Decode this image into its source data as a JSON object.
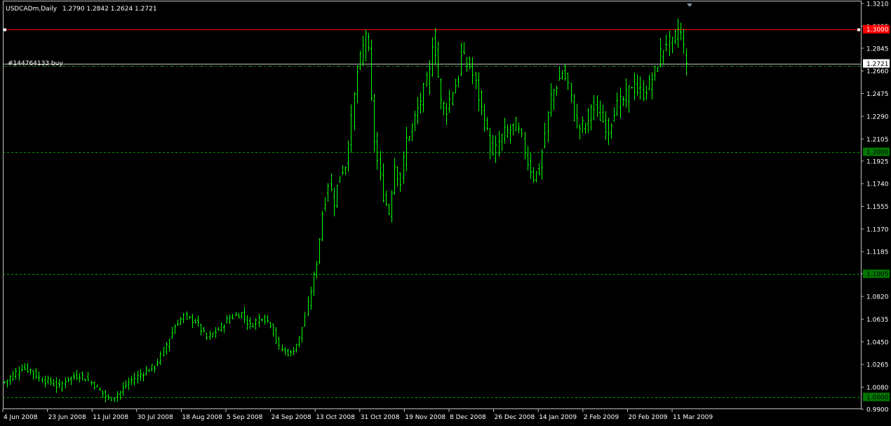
{
  "header": {
    "symbol": "USDCADm,Daily",
    "ohlc": "1.2790 1.2842 1.2624 1.2721"
  },
  "colors": {
    "background": "#000000",
    "frame": "#c0c0c0",
    "bar": "#00ff00",
    "resistance": "#ff0000",
    "order_line": "#c0c0c0",
    "grid_dash": "#00a000",
    "level_tag": "#007800",
    "text": "#ffffff"
  },
  "chart_data": {
    "type": "ohlc",
    "grid": false,
    "ylim": [
      0.99,
      1.321
    ],
    "y_ticks": [
      "1.3210",
      "1.3025",
      "1.2845",
      "1.2660",
      "1.2475",
      "1.2290",
      "1.2105",
      "1.1925",
      "1.1740",
      "1.1555",
      "1.1370",
      "1.1185",
      "1.1005",
      "1.0820",
      "1.0635",
      "1.0450",
      "1.0265",
      "1.0080",
      "0.9900"
    ],
    "x_labels": [
      "4 Jun 2008",
      "23 Jun 2008",
      "11 Jul 2008",
      "30 Jul 2008",
      "18 Aug 2008",
      "5 Sep 2008",
      "24 Sep 2008",
      "13 Oct 2008",
      "31 Oct 2008",
      "19 Nov 2008",
      "8 Dec 2008",
      "26 Dec 2008",
      "14 Jan 2009",
      "2 Feb 2009",
      "20 Feb 2009",
      "11 Mar 2009"
    ],
    "levels": [
      {
        "value": 1.3,
        "label": "1.3000",
        "style": "solid",
        "color": "#ff0000"
      },
      {
        "value": 1.2,
        "label": "1.2000",
        "style": "dashed",
        "color": "#00a000"
      },
      {
        "value": 1.1005,
        "label": "1.1005",
        "style": "dashed",
        "color": "#00a000"
      },
      {
        "value": 1.0,
        "label": "1.0000",
        "style": "dashed",
        "color": "#00a000"
      }
    ],
    "order_line": {
      "value": 1.27,
      "label": "#144764133 buy"
    },
    "current_price": {
      "value": 1.2721,
      "label": "1.2721"
    },
    "anchors": [
      [
        0,
        1.012
      ],
      [
        4,
        1.02
      ],
      [
        6,
        1.024
      ],
      [
        9,
        1.022
      ],
      [
        12,
        1.015
      ],
      [
        16,
        1.012
      ],
      [
        19,
        1.008
      ],
      [
        21,
        1.014
      ],
      [
        26,
        1.018
      ],
      [
        30,
        1.012
      ],
      [
        34,
        1.003
      ],
      [
        36,
        0.998
      ],
      [
        40,
        1.004
      ],
      [
        43,
        1.012
      ],
      [
        48,
        1.02
      ],
      [
        52,
        1.025
      ],
      [
        55,
        1.038
      ],
      [
        59,
        1.058
      ],
      [
        62,
        1.066
      ],
      [
        66,
        1.062
      ],
      [
        70,
        1.048
      ],
      [
        74,
        1.055
      ],
      [
        78,
        1.065
      ],
      [
        82,
        1.068
      ],
      [
        85,
        1.058
      ],
      [
        89,
        1.066
      ],
      [
        92,
        1.06
      ],
      [
        95,
        1.04
      ],
      [
        99,
        1.035
      ],
      [
        102,
        1.048
      ],
      [
        105,
        1.075
      ],
      [
        108,
        1.11
      ],
      [
        110,
        1.15
      ],
      [
        112,
        1.175
      ],
      [
        114,
        1.16
      ],
      [
        116,
        1.182
      ],
      [
        118,
        1.19
      ],
      [
        120,
        1.225
      ],
      [
        122,
        1.265
      ],
      [
        124,
        1.285
      ],
      [
        125,
        1.298
      ],
      [
        126,
        1.28
      ],
      [
        127,
        1.24
      ],
      [
        128,
        1.21
      ],
      [
        129,
        1.192
      ],
      [
        131,
        1.165
      ],
      [
        133,
        1.15
      ],
      [
        135,
        1.19
      ],
      [
        137,
        1.175
      ],
      [
        139,
        1.21
      ],
      [
        141,
        1.22
      ],
      [
        143,
        1.235
      ],
      [
        145,
        1.25
      ],
      [
        147,
        1.265
      ],
      [
        148,
        1.29
      ],
      [
        149,
        1.283
      ],
      [
        151,
        1.24
      ],
      [
        153,
        1.235
      ],
      [
        155,
        1.25
      ],
      [
        157,
        1.26
      ],
      [
        158,
        1.285
      ],
      [
        159,
        1.275
      ],
      [
        161,
        1.27
      ],
      [
        163,
        1.255
      ],
      [
        165,
        1.235
      ],
      [
        167,
        1.215
      ],
      [
        169,
        1.195
      ],
      [
        171,
        1.208
      ],
      [
        173,
        1.215
      ],
      [
        175,
        1.218
      ],
      [
        177,
        1.222
      ],
      [
        179,
        1.21
      ],
      [
        181,
        1.192
      ],
      [
        183,
        1.18
      ],
      [
        185,
        1.185
      ],
      [
        187,
        1.215
      ],
      [
        189,
        1.245
      ],
      [
        191,
        1.255
      ],
      [
        193,
        1.265
      ],
      [
        195,
        1.255
      ],
      [
        197,
        1.23
      ],
      [
        199,
        1.22
      ],
      [
        201,
        1.222
      ],
      [
        203,
        1.238
      ],
      [
        205,
        1.232
      ],
      [
        207,
        1.225
      ],
      [
        209,
        1.218
      ],
      [
        211,
        1.235
      ],
      [
        213,
        1.24
      ],
      [
        215,
        1.245
      ],
      [
        217,
        1.255
      ],
      [
        219,
        1.25
      ],
      [
        221,
        1.248
      ],
      [
        223,
        1.255
      ],
      [
        225,
        1.265
      ],
      [
        227,
        1.28
      ],
      [
        229,
        1.29
      ],
      [
        231,
        1.288
      ],
      [
        233,
        1.3
      ],
      [
        234,
        1.296
      ],
      [
        235,
        1.285
      ],
      [
        236,
        1.272
      ]
    ],
    "last_bar": {
      "open": 1.279,
      "high": 1.2842,
      "low": 1.2624,
      "close": 1.2721
    }
  }
}
